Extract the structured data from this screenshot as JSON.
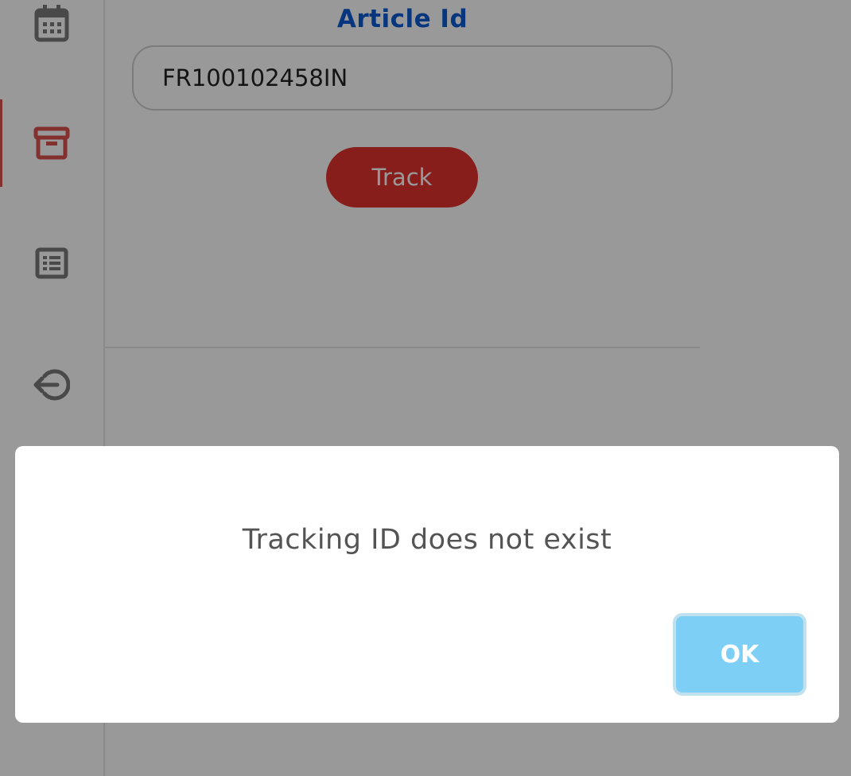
{
  "sidebar": {
    "items": [
      {
        "icon": "calendar-icon",
        "color": "#7a7a7a"
      },
      {
        "icon": "archive-icon",
        "color": "#d9534f",
        "active": true
      },
      {
        "icon": "list-icon",
        "color": "#7a7a7a"
      },
      {
        "icon": "logout-icon",
        "color": "#7a7a7a"
      }
    ]
  },
  "main": {
    "article_label": "Article Id",
    "article_value": "FR100102458IN",
    "track_label": "Track"
  },
  "dialog": {
    "message": "Tracking ID does not exist",
    "ok_label": "OK"
  },
  "colors": {
    "accent_red": "#e2332f",
    "label_blue": "#0a5bd1",
    "ok_blue": "#7ecff5"
  }
}
